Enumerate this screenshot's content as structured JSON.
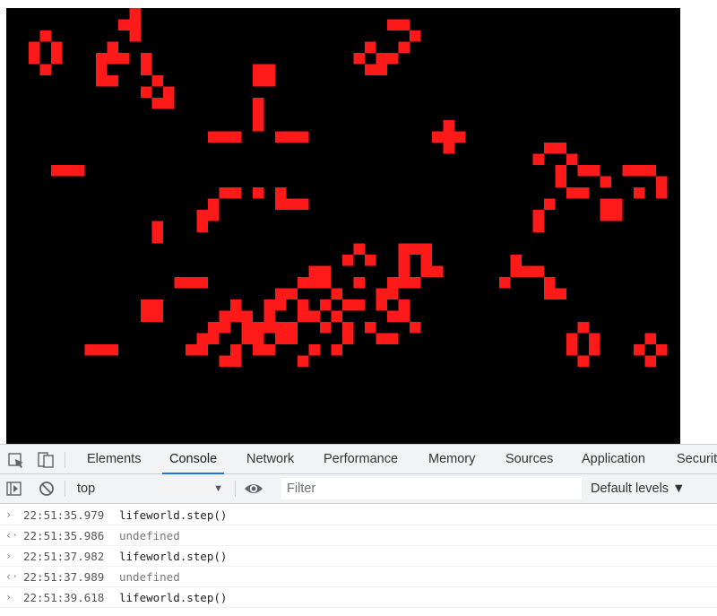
{
  "canvas": {
    "background": "#000000",
    "cell_color": "#ff1a1a"
  },
  "devtools": {
    "tabs": [
      {
        "label": "Elements",
        "active": false
      },
      {
        "label": "Console",
        "active": true
      },
      {
        "label": "Network",
        "active": false
      },
      {
        "label": "Performance",
        "active": false
      },
      {
        "label": "Memory",
        "active": false
      },
      {
        "label": "Sources",
        "active": false
      },
      {
        "label": "Application",
        "active": false
      },
      {
        "label": "Securit",
        "active": false
      }
    ],
    "toolbar": {
      "context": "top",
      "filter_placeholder": "Filter",
      "levels": "Default levels ▼"
    },
    "console": [
      {
        "kind": "input",
        "time": "22:51:35.979",
        "text": "lifeworld.step()"
      },
      {
        "kind": "output",
        "time": "22:51:35.986",
        "text": "undefined"
      },
      {
        "kind": "input",
        "time": "22:51:37.982",
        "text": "lifeworld.step()"
      },
      {
        "kind": "output",
        "time": "22:51:37.989",
        "text": "undefined"
      },
      {
        "kind": "input",
        "time": "22:51:39.618",
        "text": "lifeworld.step()"
      }
    ],
    "accent": "#1a73e8"
  }
}
